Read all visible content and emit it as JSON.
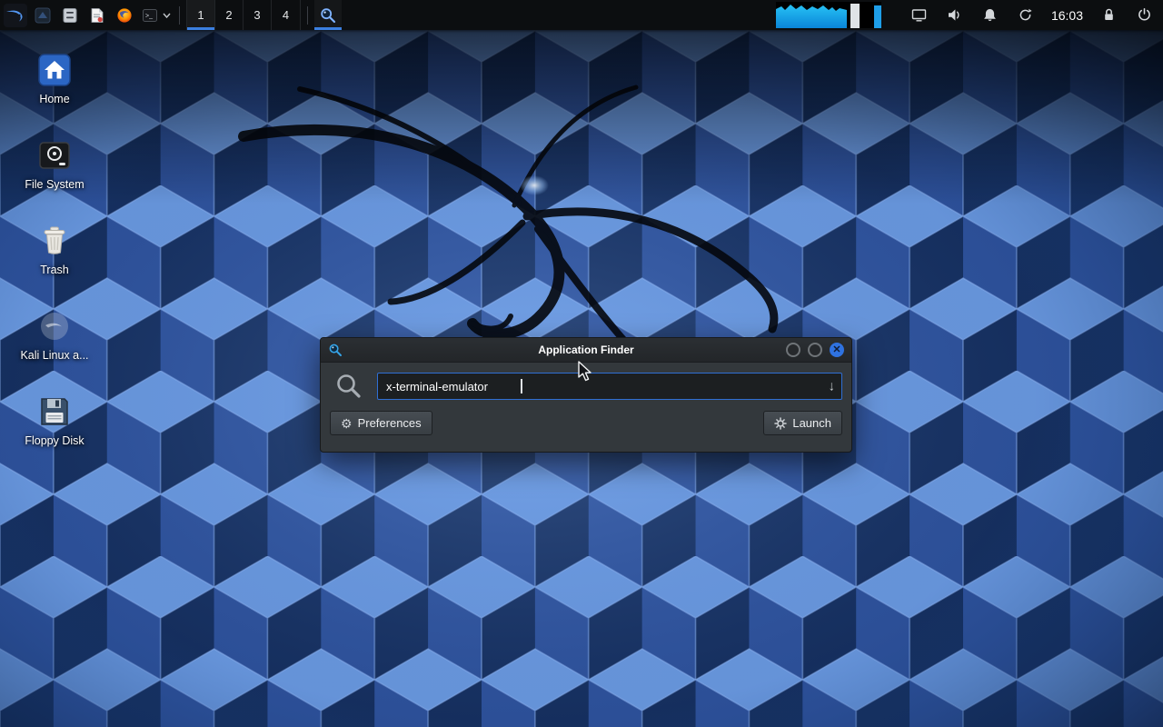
{
  "panel": {
    "clock": "16:03",
    "workspaces": [
      "1",
      "2",
      "3",
      "4"
    ],
    "active_workspace": "1",
    "launcher_names": [
      "kali-menu",
      "files",
      "file-manager",
      "text-editor",
      "firefox",
      "terminal"
    ],
    "finder_taskbar_app": "Application Finder"
  },
  "desktop_icons": [
    {
      "label": "Home"
    },
    {
      "label": "File System"
    },
    {
      "label": "Trash"
    },
    {
      "label": "Kali Linux a..."
    },
    {
      "label": "Floppy Disk"
    }
  ],
  "dialog": {
    "title": "Application Finder",
    "search_value": "x-terminal-emulator",
    "preferences_label": "Preferences",
    "launch_label": "Launch"
  },
  "icons": {
    "dropdown_arrow": "↓",
    "gear": "⚙",
    "close_glyph": "✕"
  },
  "colors": {
    "accent_blue": "#2f6fd4",
    "active_underline": "#3b7fe0",
    "close_button_blue": "#2f72e0",
    "graph_cyan": "#19b6ee",
    "panel_bg": "#0c0e10",
    "dialog_bg": "#33383c"
  }
}
